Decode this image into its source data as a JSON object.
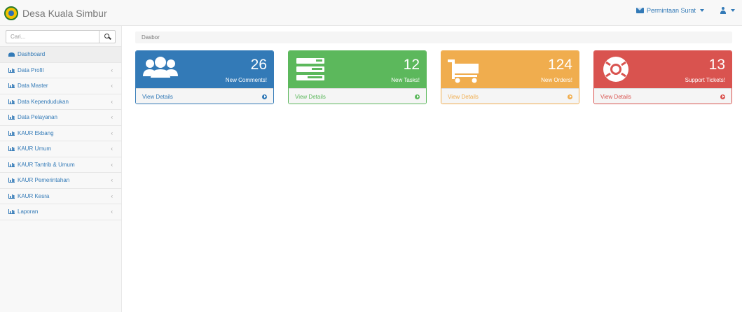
{
  "navbar": {
    "brand": "Desa Kuala Simbur",
    "brand_icon": "village-emblem-icon",
    "requests_label": "Permintaan Surat",
    "requests_icon": "envelope-icon",
    "user_icon": "user-icon"
  },
  "sidebar": {
    "search_placeholder": "Cari...",
    "search_icon": "search-icon",
    "items": [
      {
        "label": "Dashboard",
        "icon": "dashboard-icon",
        "active": true
      },
      {
        "label": "Data Profil",
        "icon": "bar-chart-icon"
      },
      {
        "label": "Data Master",
        "icon": "bar-chart-icon"
      },
      {
        "label": "Data Kependudukan",
        "icon": "bar-chart-icon"
      },
      {
        "label": "Data Pelayanan",
        "icon": "bar-chart-icon"
      },
      {
        "label": "KAUR Ekbang",
        "icon": "bar-chart-icon"
      },
      {
        "label": "KAUR Umum",
        "icon": "bar-chart-icon"
      },
      {
        "label": "KAUR Tantrib & Umum",
        "icon": "bar-chart-icon"
      },
      {
        "label": "KAUR Pemerintahan",
        "icon": "bar-chart-icon"
      },
      {
        "label": "KAUR Kesra",
        "icon": "bar-chart-icon"
      },
      {
        "label": "Laporan",
        "icon": "bar-chart-icon"
      }
    ],
    "chevron": "‹"
  },
  "breadcrumb": "Dasbor",
  "panels": [
    {
      "value": "26",
      "caption": "New Comments!",
      "link": "View Details",
      "icon": "users-icon",
      "color": "#337ab7"
    },
    {
      "value": "12",
      "caption": "New Tasks!",
      "link": "View Details",
      "icon": "tasks-icon",
      "color": "#5cb85c"
    },
    {
      "value": "124",
      "caption": "New Orders!",
      "link": "View Details",
      "icon": "shopping-cart-icon",
      "color": "#f0ad4e"
    },
    {
      "value": "13",
      "caption": "Support Tickets!",
      "link": "View Details",
      "icon": "life-ring-icon",
      "color": "#d9534f"
    }
  ]
}
